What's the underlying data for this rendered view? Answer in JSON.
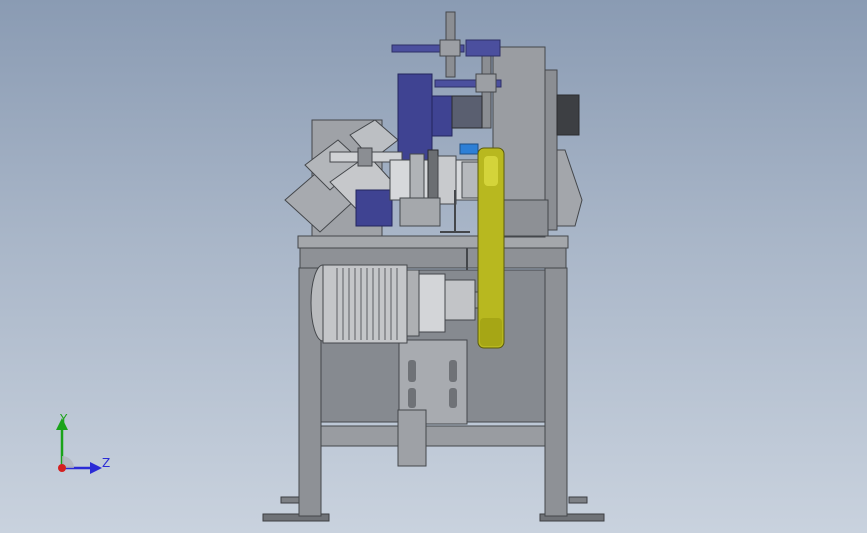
{
  "window": {
    "type": "cad-3d-viewport"
  },
  "triad": {
    "y_label": "Y",
    "z_label": "Z"
  },
  "colors": {
    "background_top": "#8a9bb3",
    "background_bottom": "#c9d2de",
    "frame": "#8e9196",
    "frame_dark": "#5e6166",
    "motor_body": "#c4c6c9",
    "belt_guard": "#b8b81f",
    "handwheel": "#4b4f9e",
    "axis_y": "#1aa31a",
    "axis_z": "#2b2bd6",
    "axis_x": "#d42020"
  }
}
